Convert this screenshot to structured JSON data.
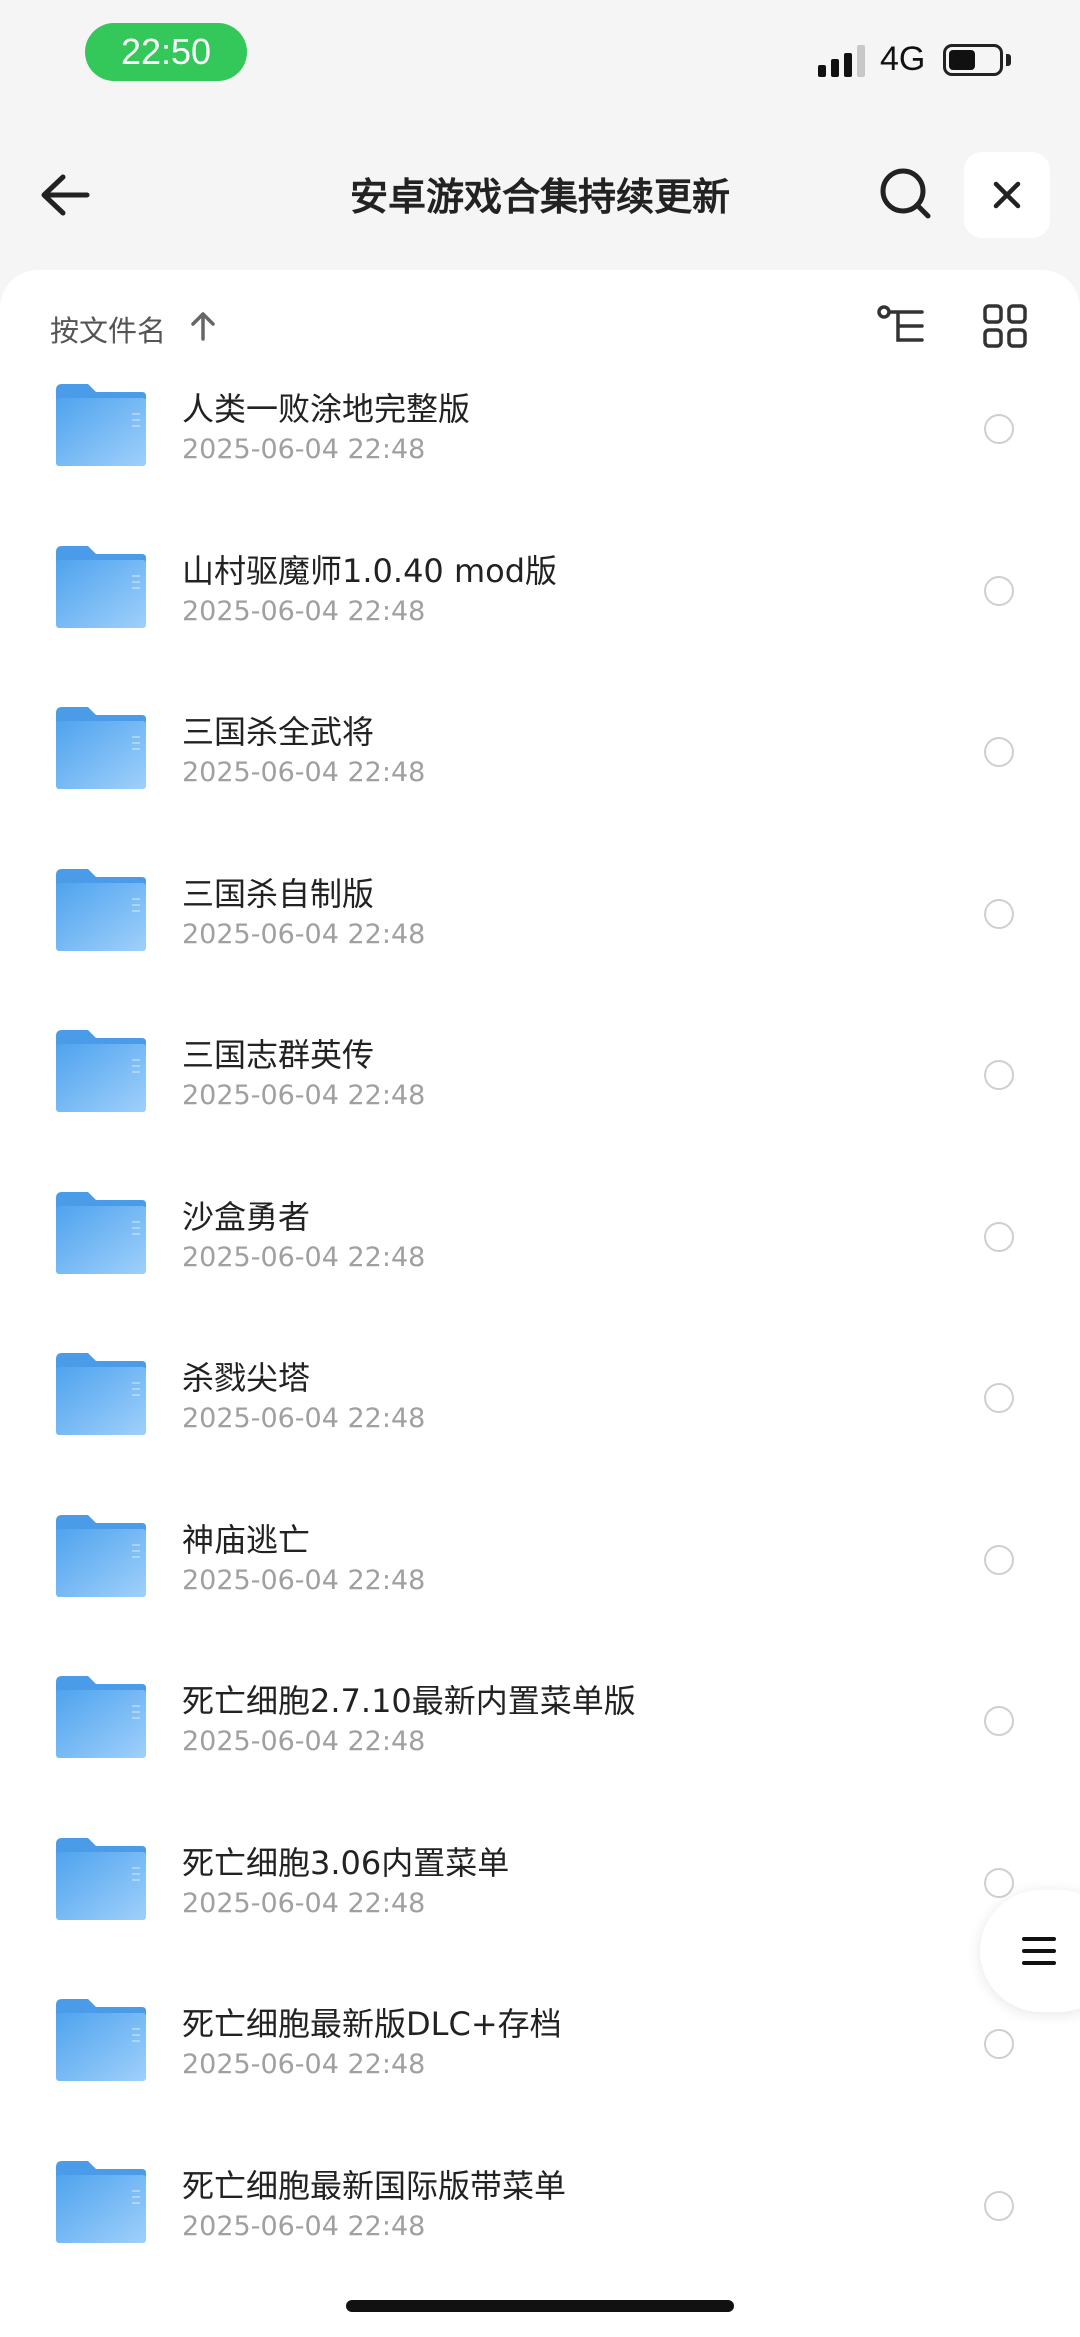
{
  "status": {
    "time": "22:50",
    "network": "4G",
    "battery_level": 0.55
  },
  "header": {
    "title": "安卓游戏合集持续更新",
    "back_icon": "arrow-left-icon",
    "search_icon": "search-icon",
    "close_icon": "close-icon"
  },
  "toolbar": {
    "sort_label": "按文件名",
    "sort_direction_icon": "arrow-up-icon",
    "tree_icon": "tree-view-icon",
    "grid_icon": "grid-view-icon"
  },
  "files": [
    {
      "name": "人类一败涂地完整版",
      "date": "2025-06-04 22:48"
    },
    {
      "name": "山村驱魔师1.0.40 mod版",
      "date": "2025-06-04 22:48"
    },
    {
      "name": "三国杀全武将",
      "date": "2025-06-04 22:48"
    },
    {
      "name": "三国杀自制版",
      "date": "2025-06-04 22:48"
    },
    {
      "name": "三国志群英传",
      "date": "2025-06-04 22:48"
    },
    {
      "name": "沙盒勇者",
      "date": "2025-06-04 22:48"
    },
    {
      "name": "杀戮尖塔",
      "date": "2025-06-04 22:48"
    },
    {
      "name": "神庙逃亡",
      "date": "2025-06-04 22:48"
    },
    {
      "name": "死亡细胞2.7.10最新内置菜单版",
      "date": "2025-06-04 22:48"
    },
    {
      "name": "死亡细胞3.06内置菜单",
      "date": "2025-06-04 22:48"
    },
    {
      "name": "死亡细胞最新版DLC+存档",
      "date": "2025-06-04 22:48"
    },
    {
      "name": "死亡细胞最新国际版带菜单",
      "date": "2025-06-04 22:48"
    }
  ],
  "colors": {
    "status_pill": "#34c759",
    "folder": "#5fb0f2",
    "date_text": "#a0a0a0"
  },
  "floating_menu_icon": "menu-lines-icon"
}
